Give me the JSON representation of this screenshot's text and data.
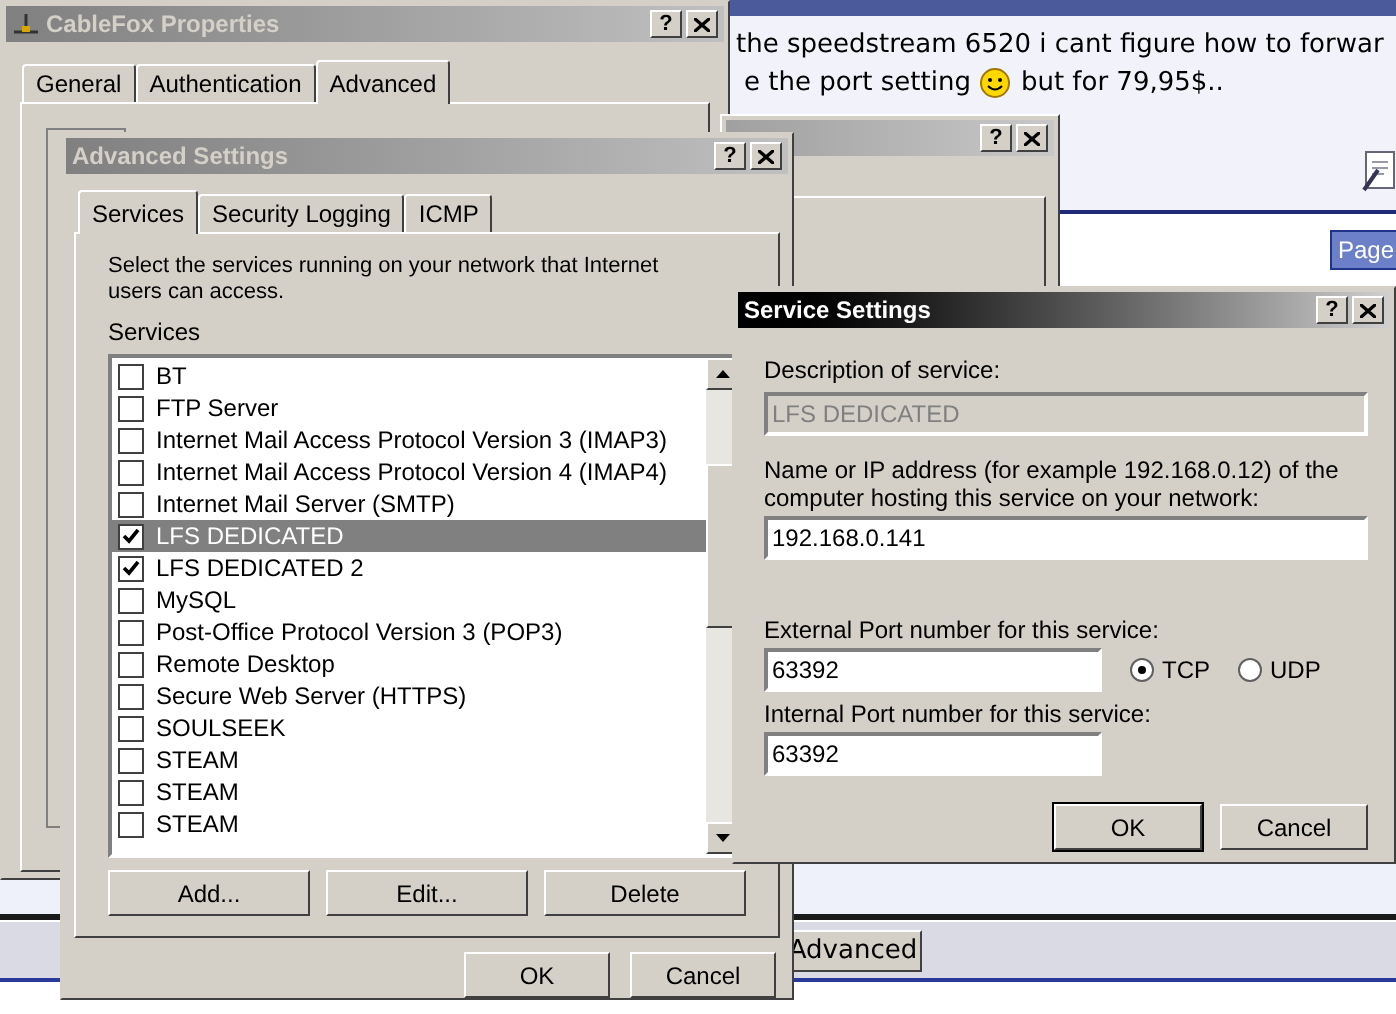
{
  "background_page": {
    "line_1": "the speedstream 6520 i cant figure how to forwar",
    "line_2": {
      "before": "e the port setting",
      "after": "but for 79,95$.."
    },
    "page_button": "Page",
    "advanced_button": "Advanced"
  },
  "cablefox_window": {
    "title": "CableFox Properties",
    "help_button": "?",
    "tabs": [
      {
        "label": "General",
        "selected": false
      },
      {
        "label": "Authentication",
        "selected": false
      },
      {
        "label": "Advanced",
        "selected": true
      }
    ]
  },
  "back_window": {
    "help_button": "?"
  },
  "advanced_settings": {
    "title": "Advanced Settings",
    "help_button": "?",
    "tabs": [
      {
        "label": "Services",
        "selected": true
      },
      {
        "label": "Security Logging",
        "selected": false
      },
      {
        "label": "ICMP",
        "selected": false
      }
    ],
    "description": "Select the services running on your network that Internet users can access.",
    "list_label": "Services",
    "services": [
      {
        "label": "BT",
        "checked": false,
        "selected": false
      },
      {
        "label": "FTP Server",
        "checked": false,
        "selected": false
      },
      {
        "label": "Internet Mail Access Protocol Version 3 (IMAP3)",
        "checked": false,
        "selected": false
      },
      {
        "label": "Internet Mail Access Protocol Version 4 (IMAP4)",
        "checked": false,
        "selected": false
      },
      {
        "label": "Internet Mail Server (SMTP)",
        "checked": false,
        "selected": false
      },
      {
        "label": "LFS DEDICATED",
        "checked": true,
        "selected": true
      },
      {
        "label": "LFS DEDICATED 2",
        "checked": true,
        "selected": false
      },
      {
        "label": "MySQL",
        "checked": false,
        "selected": false
      },
      {
        "label": "Post-Office Protocol Version 3 (POP3)",
        "checked": false,
        "selected": false
      },
      {
        "label": "Remote Desktop",
        "checked": false,
        "selected": false
      },
      {
        "label": "Secure Web Server (HTTPS)",
        "checked": false,
        "selected": false
      },
      {
        "label": "SOULSEEK",
        "checked": false,
        "selected": false
      },
      {
        "label": "STEAM",
        "checked": false,
        "selected": false
      },
      {
        "label": "STEAM",
        "checked": false,
        "selected": false
      },
      {
        "label": "STEAM",
        "checked": false,
        "selected": false
      }
    ],
    "list_buttons": [
      "Add...",
      "Edit...",
      "Delete"
    ],
    "footer_buttons": [
      "OK",
      "Cancel"
    ]
  },
  "service_settings": {
    "title": "Service Settings",
    "help_button": "?",
    "description_label": "Description of service:",
    "description_value": "LFS DEDICATED",
    "description_disabled": true,
    "host_label": "Name or IP address (for example 192.168.0.12) of the computer hosting this service on your network:",
    "host_value": "192.168.0.141",
    "external_label": "External Port number for this service:",
    "external_value": "63392",
    "protocols": [
      {
        "label": "TCP",
        "selected": true
      },
      {
        "label": "UDP",
        "selected": false
      }
    ],
    "internal_label": "Internal Port number for this service:",
    "internal_value": "63392",
    "buttons": [
      {
        "label": "OK",
        "default": true
      },
      {
        "label": "Cancel",
        "default": false
      }
    ]
  }
}
